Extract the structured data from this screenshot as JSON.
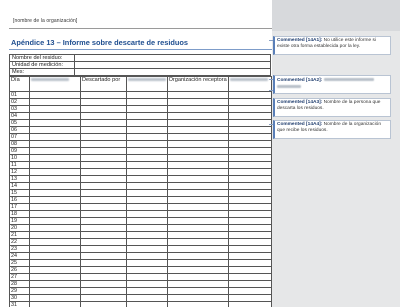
{
  "document": {
    "org_placeholder": "[nombre de la organización]",
    "title": "Apéndice 13 – Informe sobre descarte de residuos",
    "info_fields": [
      "Nombre del residuo:",
      "Unidad de medición:",
      "Mes:"
    ],
    "table": {
      "headers": [
        "Día",
        "",
        "Descartado por",
        "",
        "Organización receptora",
        ""
      ],
      "blurred_headers": [
        false,
        true,
        false,
        true,
        false,
        true
      ],
      "rows": [
        "01",
        "02",
        "03",
        "04",
        "05",
        "06",
        "07",
        "08",
        "09",
        "10",
        "11",
        "12",
        "13",
        "14",
        "15",
        "16",
        "17",
        "18",
        "19",
        "20",
        "21",
        "22",
        "23",
        "24",
        "25",
        "26",
        "27",
        "28",
        "29",
        "30",
        "31"
      ]
    }
  },
  "comments_pane": {
    "comments": [
      {
        "author": "Commented [14A1]:",
        "text": "No utilice este informe si existe otra forma establecida por la ley."
      },
      {
        "author": "Commented [14A2]:",
        "text": ""
      },
      {
        "author": "Commented [14A3]:",
        "text": "Nombre de la persona que descarta los residuos."
      },
      {
        "author": "Commented [14A4]:",
        "text": "Nombre de la organización que recibe los residuos."
      }
    ]
  },
  "colors": {
    "title": "#1f4e8f",
    "comment_accent": "#5a7fb8",
    "pane_bg": "#e6e7e8"
  }
}
